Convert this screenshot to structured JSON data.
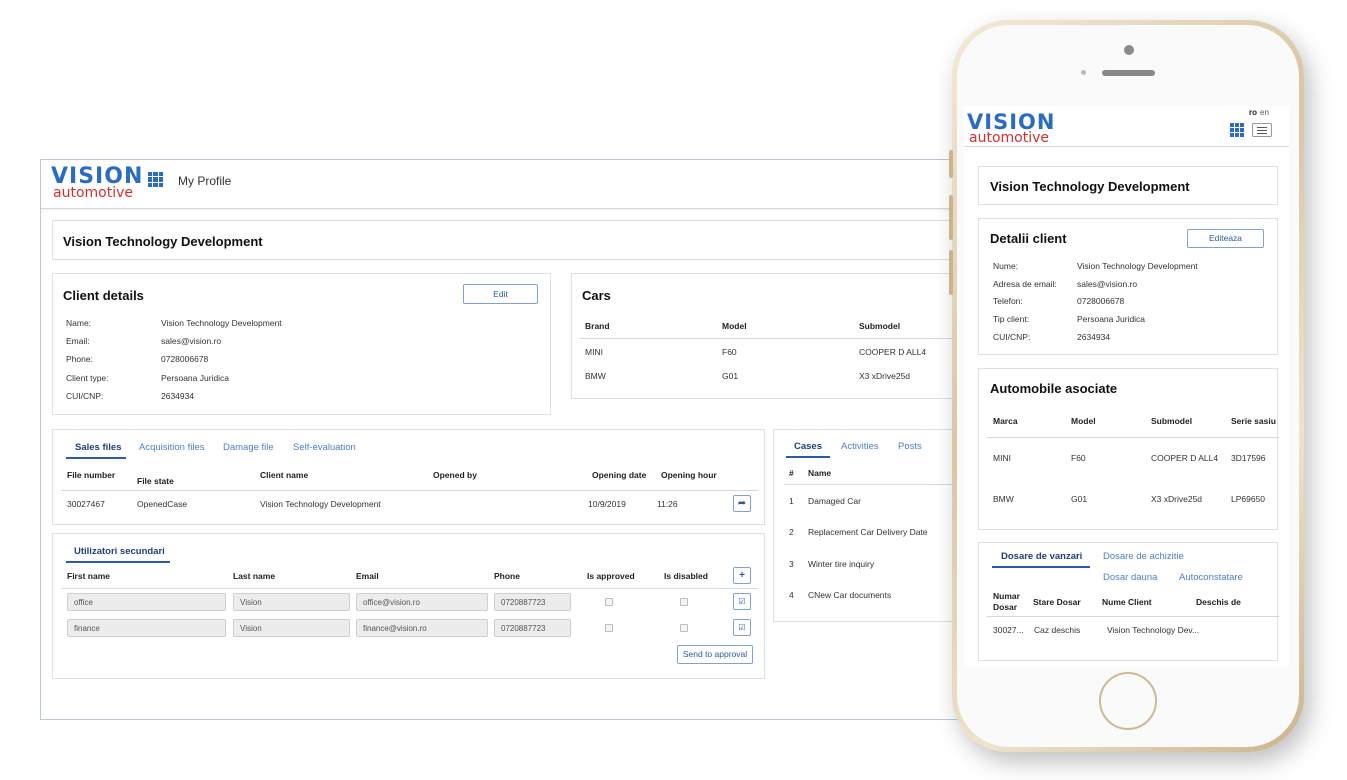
{
  "desktop": {
    "header": {
      "nav_link": "My Profile",
      "logo_top": "VISION",
      "logo_bottom": "automotive"
    },
    "company_title": "Vision Technology Development",
    "client_details": {
      "title": "Client details",
      "edit_label": "Edit",
      "rows": [
        {
          "label": "Name:",
          "value": "Vision Technology Development"
        },
        {
          "label": "Email:",
          "value": "sales@vision.ro"
        },
        {
          "label": "Phone:",
          "value": "0728006678"
        },
        {
          "label": "Client type:",
          "value": "Persoana Juridica"
        },
        {
          "label": "CUI/CNP:",
          "value": "2634934"
        }
      ]
    },
    "cars": {
      "title": "Cars",
      "headers": [
        "Brand",
        "Model",
        "Submodel"
      ],
      "rows": [
        [
          "MINI",
          "F60",
          "COOPER D ALL4"
        ],
        [
          "BMW",
          "G01",
          "X3 xDrive25d"
        ]
      ]
    },
    "files": {
      "tabs": [
        "Sales files",
        "Acquisition files",
        "Damage file",
        "Self-evaluation"
      ],
      "headers": [
        "File number",
        "File state",
        "Client name",
        "Opened by",
        "Opening date",
        "Opening hour"
      ],
      "rows": [
        [
          "30027467",
          "OpenedCase",
          "Vision Technology Development",
          "",
          "10/9/2019",
          "11:26"
        ]
      ]
    },
    "cases": {
      "tabs": [
        "Cases",
        "Activities",
        "Posts"
      ],
      "headers": [
        "#",
        "Name"
      ],
      "rows": [
        [
          "1",
          "Damaged Car"
        ],
        [
          "2",
          "Replacement Car Delivery Date"
        ],
        [
          "3",
          "Winter tire inquiry"
        ],
        [
          "4",
          "CNew Car documents"
        ]
      ]
    },
    "secondary_users": {
      "tab": "Utilizatori secundari",
      "headers": [
        "First name",
        "Last name",
        "Email",
        "Phone",
        "Is approved",
        "Is disabled"
      ],
      "rows": [
        [
          "office",
          "Vision",
          "office@vision.ro",
          "0720887723"
        ],
        [
          "finance",
          "Vision",
          "finance@vision.ro",
          "0720887723"
        ]
      ],
      "send_label": "Send to approval",
      "add_label": "+"
    }
  },
  "mobile": {
    "lang_ro": "ro",
    "lang_en": "en",
    "logo_top": "VISION",
    "logo_bottom": "automotive",
    "company_title": "Vision Technology Development",
    "client_details": {
      "title": "Detalii client",
      "edit_label": "Editeaza",
      "rows": [
        {
          "label": "Nume:",
          "value": "Vision Technology Development"
        },
        {
          "label": "Adresa de email:",
          "value": "sales@vision.ro"
        },
        {
          "label": "Telefon:",
          "value": "0728006678"
        },
        {
          "label": "Tip client:",
          "value": "Persoana Juridica"
        },
        {
          "label": "CUI/CNP:",
          "value": "2634934"
        }
      ]
    },
    "cars": {
      "title": "Automobile asociate",
      "headers": [
        "Marca",
        "Model",
        "Submodel",
        "Serie sasiu"
      ],
      "rows": [
        [
          "MINI",
          "F60",
          "COOPER D ALL4",
          "3D17596"
        ],
        [
          "BMW",
          "G01",
          "X3 xDrive25d",
          "LP69650"
        ]
      ]
    },
    "files": {
      "tabs": [
        "Dosare de vanzari",
        "Dosare de achizitie",
        "Dosar dauna",
        "Autoconstatare"
      ],
      "headers": [
        "Numar Dosar",
        "Stare Dosar",
        "Nume Client",
        "Deschis de"
      ],
      "rows": [
        [
          "30027...",
          "Caz deschis",
          "Vision Technology Dev..."
        ]
      ]
    }
  },
  "colors": {
    "brand_blue": "#2a6cc4",
    "brand_red": "#d32f2f",
    "link": "#4d7fc4",
    "tab_active": "#1f3e7a"
  }
}
